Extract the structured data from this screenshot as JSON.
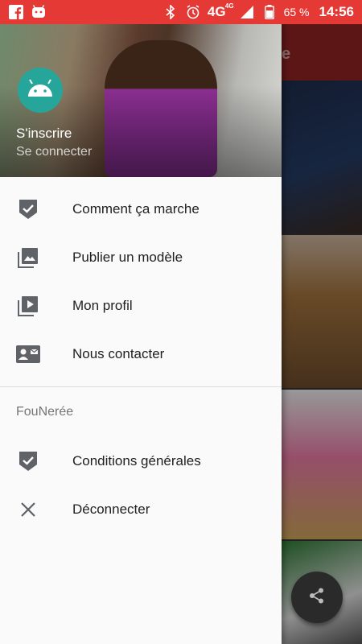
{
  "status_bar": {
    "left_icons": [
      "facebook-icon",
      "android-debug-icon"
    ],
    "network": "4G",
    "network_sup": "4G",
    "battery": "65 %",
    "time": "14:56",
    "background_color": "#e53935"
  },
  "app_bar": {
    "title_fragment": "e"
  },
  "drawer": {
    "header": {
      "primary": "S'inscrire",
      "secondary": "Se connecter"
    },
    "items": [
      {
        "label": "Comment ça marche",
        "icon": "shield-check-icon"
      },
      {
        "label": "Publier un modèle",
        "icon": "photo-library-icon"
      },
      {
        "label": "Mon profil",
        "icon": "video-library-icon"
      },
      {
        "label": "Nous contacter",
        "icon": "contact-card-icon"
      }
    ],
    "section": {
      "title": "FouNerée",
      "items": [
        {
          "label": "Conditions générales",
          "icon": "shield-check-icon"
        },
        {
          "label": "Déconnecter",
          "icon": "close-icon"
        }
      ]
    }
  },
  "fab": {
    "icon": "share-icon"
  },
  "colors": {
    "accent": "#26a69a",
    "status_bar": "#e53935",
    "app_bar": "#8e2222"
  }
}
